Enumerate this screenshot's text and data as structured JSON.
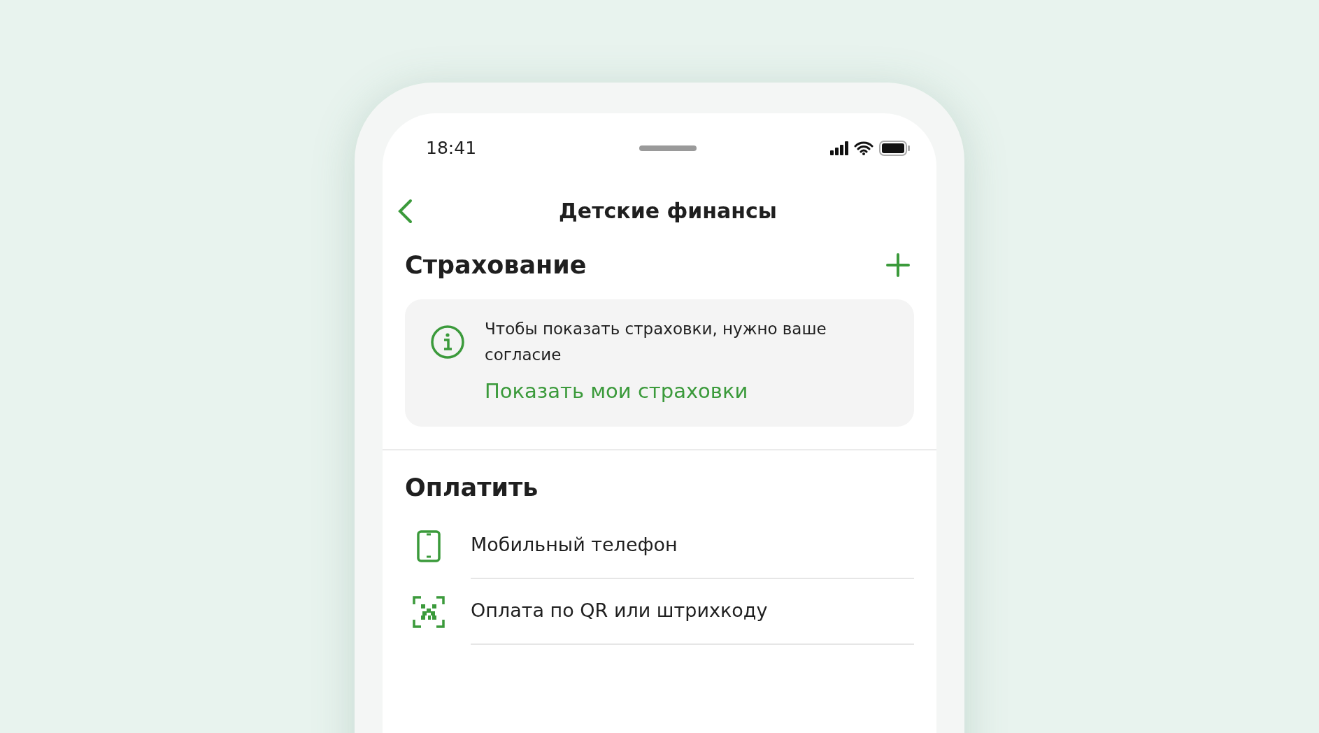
{
  "status_bar": {
    "time": "18:41"
  },
  "header": {
    "title": "Детские финансы"
  },
  "insurance": {
    "title": "Страхование",
    "notice": {
      "text": "Чтобы показать страховки, нужно ваше согласие",
      "link": "Показать мои страховки"
    }
  },
  "payment": {
    "title": "Оплатить",
    "items": [
      {
        "kind": "phone",
        "label": "Мобильный телефон"
      },
      {
        "kind": "qr",
        "label": "Оплата по QR или штрихкоду"
      }
    ]
  }
}
